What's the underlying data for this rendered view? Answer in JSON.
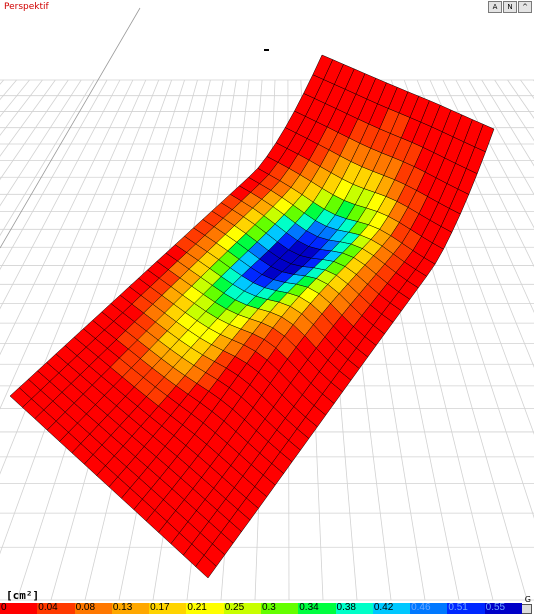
{
  "view": {
    "title": "Perspektif"
  },
  "toolbar": {
    "buttons": [
      "A",
      "N",
      "^"
    ]
  },
  "legend": {
    "unit": "[cm²]",
    "labels": [
      "0",
      "0.04",
      "0.08",
      "0.13",
      "0.17",
      "0.21",
      "0.25",
      "0.3",
      "0.34",
      "0.38",
      "0.42",
      "0.46",
      "0.51",
      "0.55"
    ],
    "colors": [
      "#ff0000",
      "#ff3a00",
      "#ff7800",
      "#ffa800",
      "#ffd400",
      "#ffff00",
      "#c8ff00",
      "#64ff00",
      "#00ff40",
      "#00ffc8",
      "#00c8ff",
      "#0078ff",
      "#0028ff",
      "#0000c8"
    ]
  },
  "corner": {
    "label": "G"
  }
}
